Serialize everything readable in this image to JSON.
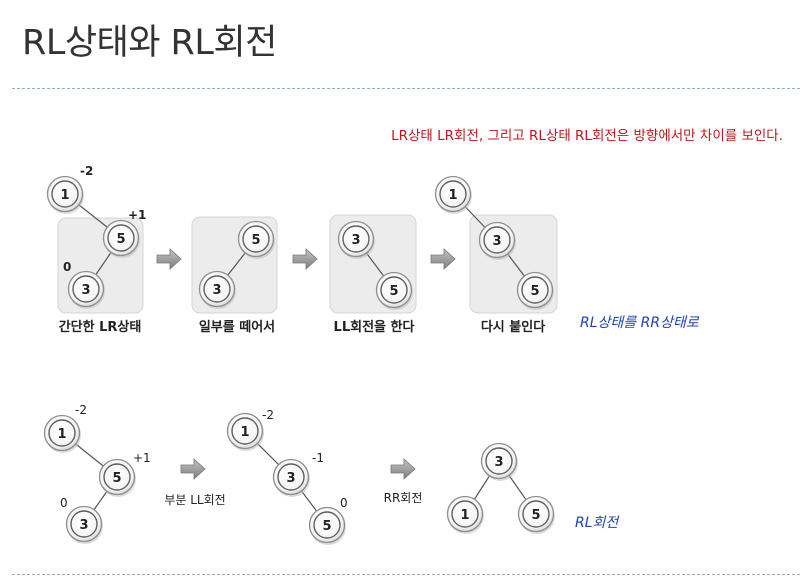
{
  "title": "RL상태와 RL회전",
  "note": "LR상태 LR회전, 그리고 RL상태 RL회전은 방향에서만 차이를 보인다.",
  "top_row": {
    "captions": [
      "간단한 LR상태",
      "일부를 떼어서",
      "LL회전을 한다",
      "다시 붙인다"
    ],
    "handwritten": "RL상태를 RR상태로",
    "balance": {
      "n1": "-2",
      "n5": "+1",
      "n3": "0"
    }
  },
  "bottom_row": {
    "step1_label": "부분 LL회전",
    "step2_label": "RR회전",
    "handwritten": "RL회전",
    "balance_a": {
      "n1": "-2",
      "n5": "+1",
      "n3": "0"
    },
    "balance_b": {
      "n1": "-2",
      "n3": "-1",
      "n5": "0"
    }
  },
  "nodes": {
    "one": "1",
    "three": "3",
    "five": "5"
  }
}
